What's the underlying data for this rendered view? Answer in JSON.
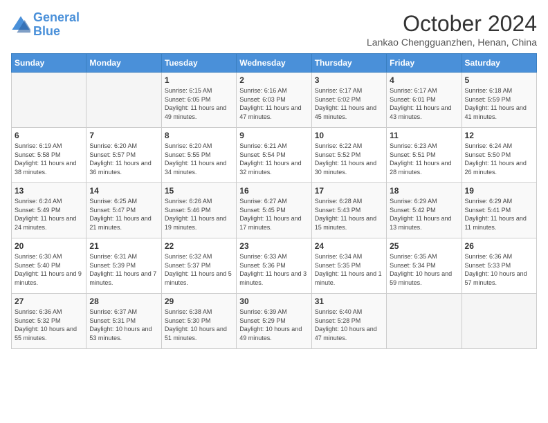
{
  "logo": {
    "line1": "General",
    "line2": "Blue"
  },
  "title": "October 2024",
  "location": "Lankao Chengguanzhen, Henan, China",
  "weekdays": [
    "Sunday",
    "Monday",
    "Tuesday",
    "Wednesday",
    "Thursday",
    "Friday",
    "Saturday"
  ],
  "weeks": [
    [
      {
        "day": "",
        "sunrise": "",
        "sunset": "",
        "daylight": ""
      },
      {
        "day": "",
        "sunrise": "",
        "sunset": "",
        "daylight": ""
      },
      {
        "day": "1",
        "sunrise": "Sunrise: 6:15 AM",
        "sunset": "Sunset: 6:05 PM",
        "daylight": "Daylight: 11 hours and 49 minutes."
      },
      {
        "day": "2",
        "sunrise": "Sunrise: 6:16 AM",
        "sunset": "Sunset: 6:03 PM",
        "daylight": "Daylight: 11 hours and 47 minutes."
      },
      {
        "day": "3",
        "sunrise": "Sunrise: 6:17 AM",
        "sunset": "Sunset: 6:02 PM",
        "daylight": "Daylight: 11 hours and 45 minutes."
      },
      {
        "day": "4",
        "sunrise": "Sunrise: 6:17 AM",
        "sunset": "Sunset: 6:01 PM",
        "daylight": "Daylight: 11 hours and 43 minutes."
      },
      {
        "day": "5",
        "sunrise": "Sunrise: 6:18 AM",
        "sunset": "Sunset: 5:59 PM",
        "daylight": "Daylight: 11 hours and 41 minutes."
      }
    ],
    [
      {
        "day": "6",
        "sunrise": "Sunrise: 6:19 AM",
        "sunset": "Sunset: 5:58 PM",
        "daylight": "Daylight: 11 hours and 38 minutes."
      },
      {
        "day": "7",
        "sunrise": "Sunrise: 6:20 AM",
        "sunset": "Sunset: 5:57 PM",
        "daylight": "Daylight: 11 hours and 36 minutes."
      },
      {
        "day": "8",
        "sunrise": "Sunrise: 6:20 AM",
        "sunset": "Sunset: 5:55 PM",
        "daylight": "Daylight: 11 hours and 34 minutes."
      },
      {
        "day": "9",
        "sunrise": "Sunrise: 6:21 AM",
        "sunset": "Sunset: 5:54 PM",
        "daylight": "Daylight: 11 hours and 32 minutes."
      },
      {
        "day": "10",
        "sunrise": "Sunrise: 6:22 AM",
        "sunset": "Sunset: 5:52 PM",
        "daylight": "Daylight: 11 hours and 30 minutes."
      },
      {
        "day": "11",
        "sunrise": "Sunrise: 6:23 AM",
        "sunset": "Sunset: 5:51 PM",
        "daylight": "Daylight: 11 hours and 28 minutes."
      },
      {
        "day": "12",
        "sunrise": "Sunrise: 6:24 AM",
        "sunset": "Sunset: 5:50 PM",
        "daylight": "Daylight: 11 hours and 26 minutes."
      }
    ],
    [
      {
        "day": "13",
        "sunrise": "Sunrise: 6:24 AM",
        "sunset": "Sunset: 5:49 PM",
        "daylight": "Daylight: 11 hours and 24 minutes."
      },
      {
        "day": "14",
        "sunrise": "Sunrise: 6:25 AM",
        "sunset": "Sunset: 5:47 PM",
        "daylight": "Daylight: 11 hours and 21 minutes."
      },
      {
        "day": "15",
        "sunrise": "Sunrise: 6:26 AM",
        "sunset": "Sunset: 5:46 PM",
        "daylight": "Daylight: 11 hours and 19 minutes."
      },
      {
        "day": "16",
        "sunrise": "Sunrise: 6:27 AM",
        "sunset": "Sunset: 5:45 PM",
        "daylight": "Daylight: 11 hours and 17 minutes."
      },
      {
        "day": "17",
        "sunrise": "Sunrise: 6:28 AM",
        "sunset": "Sunset: 5:43 PM",
        "daylight": "Daylight: 11 hours and 15 minutes."
      },
      {
        "day": "18",
        "sunrise": "Sunrise: 6:29 AM",
        "sunset": "Sunset: 5:42 PM",
        "daylight": "Daylight: 11 hours and 13 minutes."
      },
      {
        "day": "19",
        "sunrise": "Sunrise: 6:29 AM",
        "sunset": "Sunset: 5:41 PM",
        "daylight": "Daylight: 11 hours and 11 minutes."
      }
    ],
    [
      {
        "day": "20",
        "sunrise": "Sunrise: 6:30 AM",
        "sunset": "Sunset: 5:40 PM",
        "daylight": "Daylight: 11 hours and 9 minutes."
      },
      {
        "day": "21",
        "sunrise": "Sunrise: 6:31 AM",
        "sunset": "Sunset: 5:39 PM",
        "daylight": "Daylight: 11 hours and 7 minutes."
      },
      {
        "day": "22",
        "sunrise": "Sunrise: 6:32 AM",
        "sunset": "Sunset: 5:37 PM",
        "daylight": "Daylight: 11 hours and 5 minutes."
      },
      {
        "day": "23",
        "sunrise": "Sunrise: 6:33 AM",
        "sunset": "Sunset: 5:36 PM",
        "daylight": "Daylight: 11 hours and 3 minutes."
      },
      {
        "day": "24",
        "sunrise": "Sunrise: 6:34 AM",
        "sunset": "Sunset: 5:35 PM",
        "daylight": "Daylight: 11 hours and 1 minute."
      },
      {
        "day": "25",
        "sunrise": "Sunrise: 6:35 AM",
        "sunset": "Sunset: 5:34 PM",
        "daylight": "Daylight: 10 hours and 59 minutes."
      },
      {
        "day": "26",
        "sunrise": "Sunrise: 6:36 AM",
        "sunset": "Sunset: 5:33 PM",
        "daylight": "Daylight: 10 hours and 57 minutes."
      }
    ],
    [
      {
        "day": "27",
        "sunrise": "Sunrise: 6:36 AM",
        "sunset": "Sunset: 5:32 PM",
        "daylight": "Daylight: 10 hours and 55 minutes."
      },
      {
        "day": "28",
        "sunrise": "Sunrise: 6:37 AM",
        "sunset": "Sunset: 5:31 PM",
        "daylight": "Daylight: 10 hours and 53 minutes."
      },
      {
        "day": "29",
        "sunrise": "Sunrise: 6:38 AM",
        "sunset": "Sunset: 5:30 PM",
        "daylight": "Daylight: 10 hours and 51 minutes."
      },
      {
        "day": "30",
        "sunrise": "Sunrise: 6:39 AM",
        "sunset": "Sunset: 5:29 PM",
        "daylight": "Daylight: 10 hours and 49 minutes."
      },
      {
        "day": "31",
        "sunrise": "Sunrise: 6:40 AM",
        "sunset": "Sunset: 5:28 PM",
        "daylight": "Daylight: 10 hours and 47 minutes."
      },
      {
        "day": "",
        "sunrise": "",
        "sunset": "",
        "daylight": ""
      },
      {
        "day": "",
        "sunrise": "",
        "sunset": "",
        "daylight": ""
      }
    ]
  ]
}
